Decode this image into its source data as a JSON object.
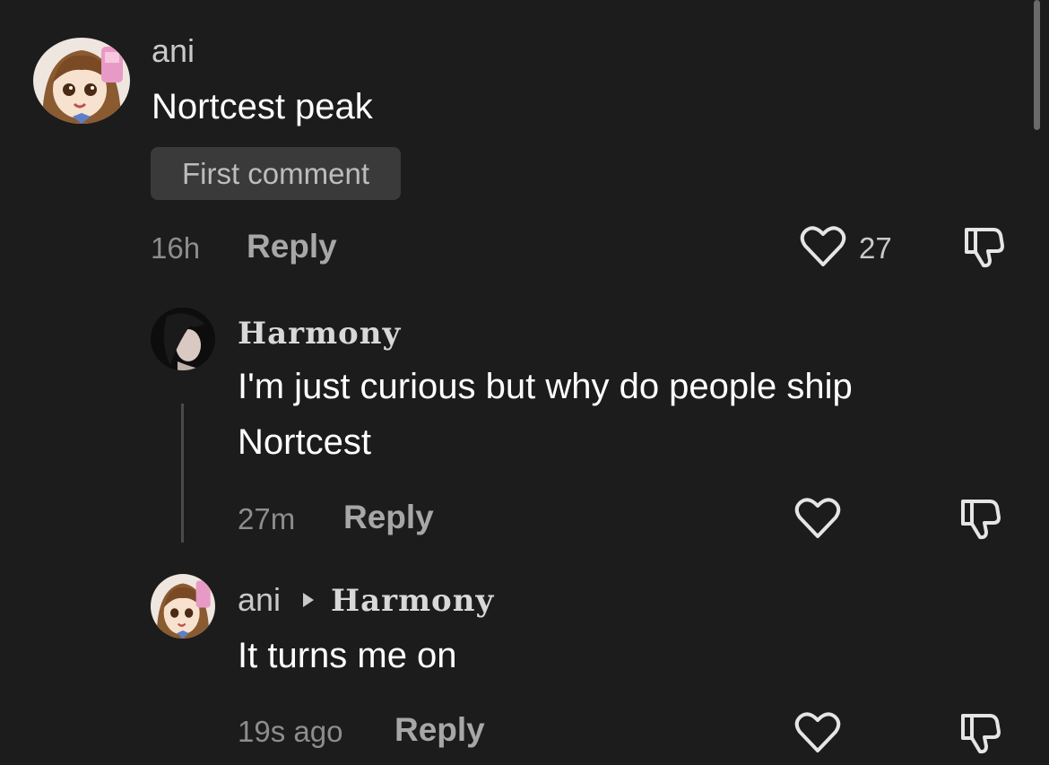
{
  "colors": {
    "background": "#1c1c1c",
    "text_primary": "#ffffff",
    "text_secondary": "#8d8d8d",
    "badge_bg": "#3a3a3a"
  },
  "comments": [
    {
      "username": "ani",
      "text": "Nortcest peak",
      "badge": "First comment",
      "time": "16h",
      "reply_label": "Reply",
      "like_count": "27",
      "like_icon": "heart-outline-icon",
      "dislike_icon": "thumbs-down-icon"
    },
    {
      "username": "Harmony",
      "text_line1": "I'm just curious but why do people ship",
      "text_line2": "Nortcest",
      "time": "27m",
      "reply_label": "Reply",
      "like_icon": "heart-outline-icon",
      "dislike_icon": "thumbs-down-icon"
    },
    {
      "username": "ani",
      "reply_to": "Harmony",
      "text": "It turns me on",
      "time": "19s ago",
      "reply_label": "Reply",
      "like_icon": "heart-outline-icon",
      "dislike_icon": "thumbs-down-icon"
    }
  ]
}
